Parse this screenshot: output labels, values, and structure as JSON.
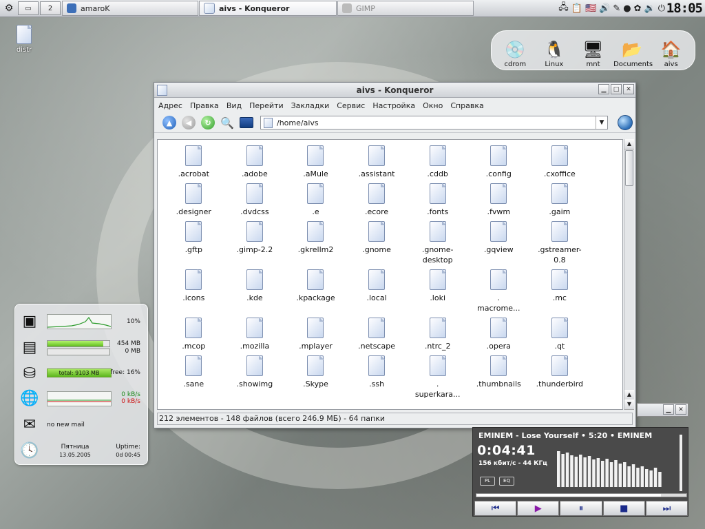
{
  "panel": {
    "desktop_number": "2",
    "tasks": [
      {
        "label": "amaroK",
        "icon_color": "#3d6fb8"
      },
      {
        "label": "aivs - Konqueror",
        "icon_color": "#7d8fb0"
      },
      {
        "label": "GIMP",
        "icon_color": "#aaaaaa"
      }
    ],
    "clock": "18:05"
  },
  "desktop_icon": {
    "label": "distr"
  },
  "devices": [
    {
      "label": "cdrom",
      "glyph": "💿"
    },
    {
      "label": "Linux",
      "glyph": "🐧"
    },
    {
      "label": "mnt",
      "glyph": "🖥"
    },
    {
      "label": "Documents",
      "glyph": "📂"
    },
    {
      "label": "aivs",
      "glyph": "🏠"
    }
  ],
  "konqueror": {
    "title": "aivs - Konqueror",
    "menu": [
      "Адрес",
      "Правка",
      "Вид",
      "Перейти",
      "Закладки",
      "Сервис",
      "Настройка",
      "Окно",
      "Справка"
    ],
    "location": "/home/aivs",
    "files": [
      ".acrobat",
      ".adobe",
      ".aMule",
      ".assistant",
      ".cddb",
      ".config",
      ".cxoffice",
      ".designer",
      ".dvdcss",
      ".e",
      ".ecore",
      ".fonts",
      ".fvwm",
      ".gaim",
      ".gftp",
      ".gimp-2.2",
      ".gkrellm2",
      ".gnome",
      ".gnome-\ndesktop",
      ".gqview",
      ".gstreamer-\n0.8",
      ".icons",
      ".kde",
      ".kpackage",
      ".local",
      ".loki",
      ".\nmacrome...",
      ".mc",
      ".mcop",
      ".mozilla",
      ".mplayer",
      ".netscape",
      ".ntrc_2",
      ".opera",
      ".qt",
      ".sane",
      ".showimg",
      ".Skype",
      ".ssh",
      ".\nsuperkara...",
      ".thumbnails",
      ".thunderbird"
    ],
    "status": "212 элементов - 148 файлов (всего 246.9 МБ) - 64 папки"
  },
  "monitor": {
    "cpu": "10%",
    "mem_used": "454 MB",
    "swap_used": "0 MB",
    "mem_fill": 0.9,
    "disk_total": "total: 9103 MB",
    "disk_free": "free: 16%",
    "net_in": "0 kB/s",
    "net_out": "0 kB/s",
    "mail": "no new mail",
    "day": "Пятница",
    "date": "13.05.2005",
    "uptime_label": "Uptime:",
    "uptime": "0d 00:45",
    "colors": {
      "net_in": "#1a8a1a",
      "net_out": "#cc1111"
    }
  },
  "xmms": {
    "marquee": "EMINEM - Lose Yourself  •  5:20  •  EMINEM",
    "time": "0:04:41",
    "bitrate": "156 кбит/с - 44 КГц",
    "pl": "PL",
    "eq": "EQ",
    "progress": 0.88
  }
}
